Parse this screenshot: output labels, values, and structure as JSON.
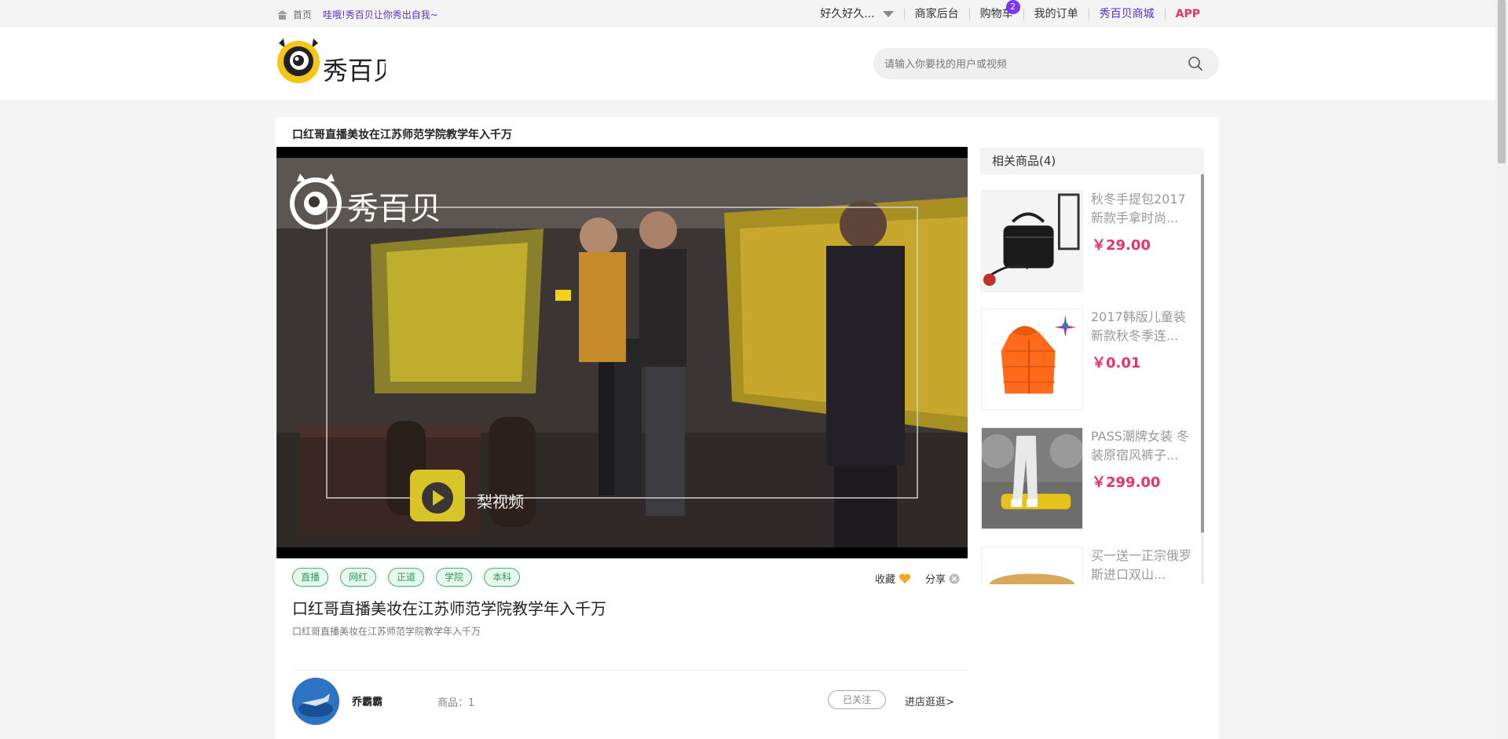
{
  "topbar": {
    "home_label": "首页",
    "slogan": "哇哦!秀百贝让你秀出自我~",
    "user_name": "好久好久...",
    "nav": {
      "merchant": "商家后台",
      "cart": "购物车",
      "cart_count": "2",
      "orders": "我的订单",
      "mall": "秀百贝商城",
      "app": "APP"
    }
  },
  "header": {
    "logo_text": "秀百贝",
    "search_placeholder": "请输入你要找的用户或视频"
  },
  "video": {
    "page_title": "口红哥直播美妆在江苏师范学院教学年入千万",
    "watermark": "秀百贝",
    "source_label": "梨视频",
    "tags": [
      "直播",
      "网红",
      "正道",
      "学院",
      "本科"
    ],
    "collect_label": "收藏",
    "share_label": "分享",
    "title": "口红哥直播美妆在江苏师范学院教学年入千万",
    "description": "口红哥直播美妆在江苏师范学院教学年入千万"
  },
  "author": {
    "name": "乔霸霸",
    "goods_label": "商品：1",
    "follow_label": "已关注",
    "shop_link": "进店逛逛>"
  },
  "related": {
    "title": "相关商品(4)",
    "products": [
      {
        "name": "秋冬手提包2017新款手拿时尚...",
        "price": "￥29.00",
        "image": "black-handbag"
      },
      {
        "name": "2017韩版儿童装新款秋冬季连...",
        "price": "￥0.01",
        "image": "orange-kids-jacket"
      },
      {
        "name": "PASS潮牌女装 冬装原宿风裤子...",
        "price": "￥299.00",
        "image": "white-pants"
      },
      {
        "name": "买一送一正宗俄罗斯进口双山...",
        "price": "",
        "image": "bread"
      }
    ]
  },
  "colors": {
    "brand_purple": "#5b2fc6",
    "price_pink": "#e6336a",
    "tag_green": "#3cb371",
    "logo_yellow": "#f5c518"
  }
}
